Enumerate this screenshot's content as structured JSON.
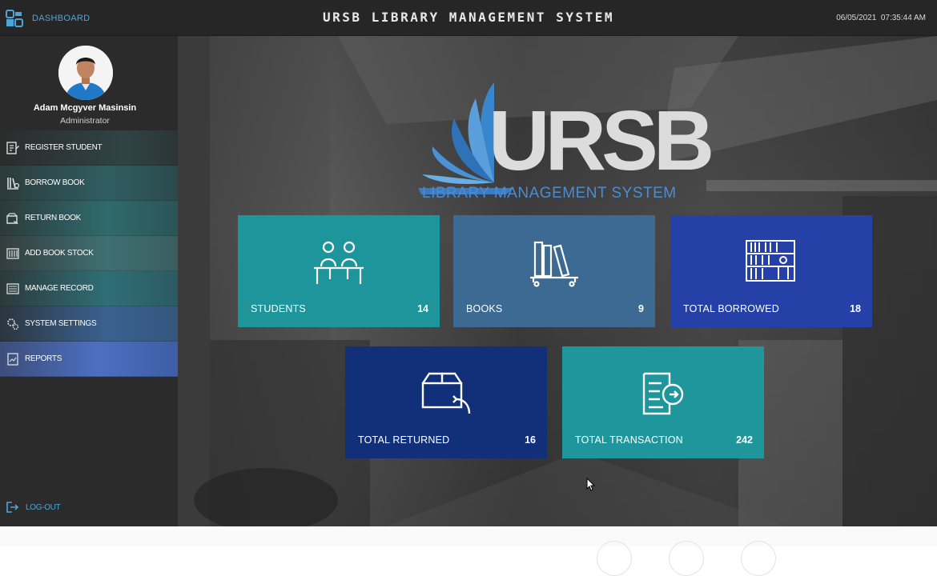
{
  "header": {
    "dashboard_label": "DASHBOARD",
    "app_title": "URSB LIBRARY MANAGEMENT SYSTEM",
    "date": "06/05/2021",
    "time": "07:35:44 AM"
  },
  "user": {
    "name": "Adam Mcgyver Masinsin",
    "role": "Administrator"
  },
  "sidebar": {
    "items": [
      {
        "label": "REGISTER STUDENT",
        "icon": "register-icon",
        "bg": "#2f3f41"
      },
      {
        "label": "BORROW BOOK",
        "icon": "borrow-book-icon",
        "bg": "#2e5558"
      },
      {
        "label": "RETURN BOOK",
        "icon": "return-book-icon",
        "bg": "#2f6365"
      },
      {
        "label": "ADD BOOK STOCK",
        "icon": "add-stock-icon",
        "bg": "#3a6a6c"
      },
      {
        "label": "MANAGE RECORD",
        "icon": "manage-record-icon",
        "bg": "#2f6a72"
      },
      {
        "label": "SYSTEM SETTINGS",
        "icon": "settings-icon",
        "bg": "#3a5f86"
      },
      {
        "label": "REPORTS",
        "icon": "reports-icon",
        "bg": "#4a6bb8"
      }
    ],
    "logout_label": "LOG-OUT"
  },
  "logo": {
    "word": "URSB",
    "subtitle": "LIBRARY MANAGEMENT SYSTEM"
  },
  "tiles": [
    {
      "label": "STUDENTS",
      "count": "14",
      "icon": "students-icon",
      "color": "#1e959b"
    },
    {
      "label": "BOOKS",
      "count": "9",
      "icon": "books-icon",
      "color": "#3d6a92"
    },
    {
      "label": "TOTAL BORROWED",
      "count": "18",
      "icon": "bookshelf-icon",
      "color": "#2541a8"
    },
    {
      "label": "TOTAL RETURNED",
      "count": "16",
      "icon": "return-box-icon",
      "color": "#12307a"
    },
    {
      "label": "TOTAL TRANSACTION",
      "count": "242",
      "icon": "transaction-icon",
      "color": "#1f969c"
    }
  ]
}
